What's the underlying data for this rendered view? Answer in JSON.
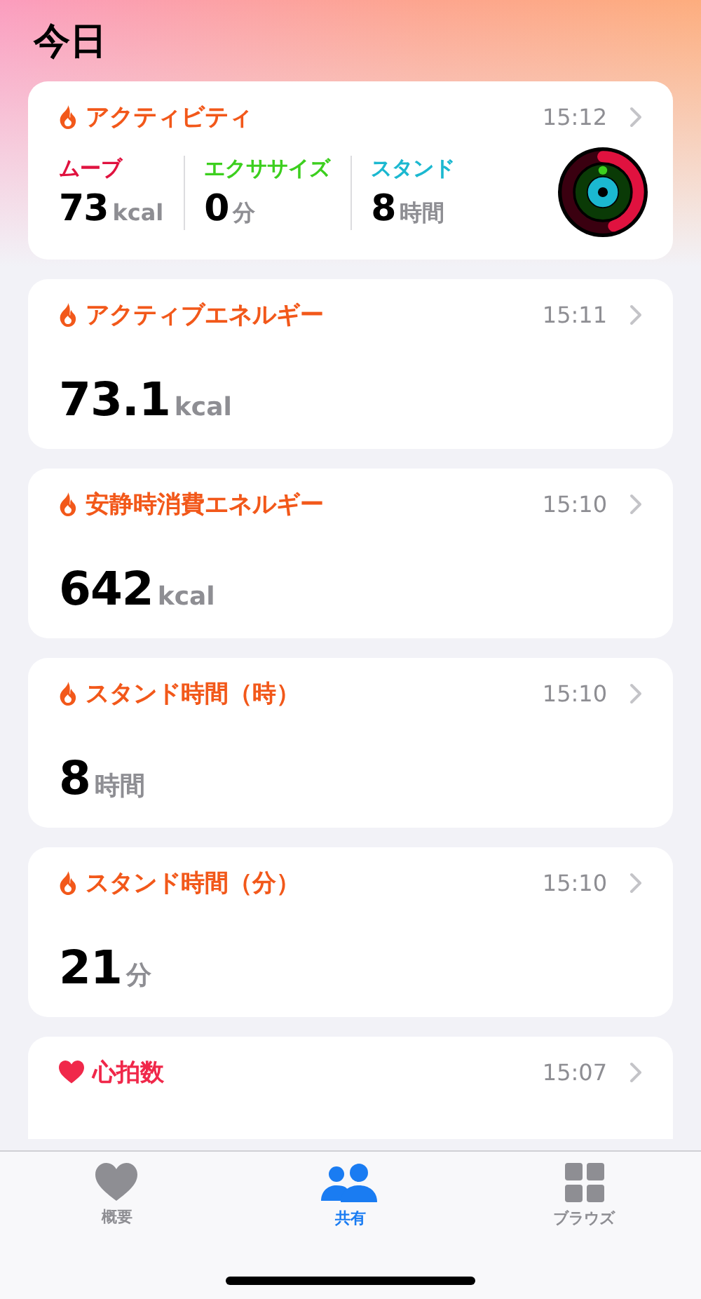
{
  "title": "今日",
  "activity_card": {
    "title": "アクティビティ",
    "time": "15:12",
    "metrics": [
      {
        "name": "ムーブ",
        "value": "73",
        "unit": "kcal",
        "color": "#e0123f"
      },
      {
        "name": "エクササイズ",
        "value": "0",
        "unit": "分",
        "color": "#3ccf1e"
      },
      {
        "name": "スタンド",
        "value": "8",
        "unit": "時間",
        "color": "#1bb8d0"
      }
    ]
  },
  "cards": [
    {
      "kind": "flame",
      "title": "アクティブエネルギー",
      "time": "15:11",
      "value": "73.1",
      "unit": "kcal"
    },
    {
      "kind": "flame",
      "title": "安静時消費エネルギー",
      "time": "15:10",
      "value": "642",
      "unit": "kcal"
    },
    {
      "kind": "flame",
      "title": "スタンド時間（時）",
      "time": "15:10",
      "value": "8",
      "unit": "時間"
    },
    {
      "kind": "flame",
      "title": "スタンド時間（分）",
      "time": "15:10",
      "value": "21",
      "unit": "分"
    },
    {
      "kind": "heart",
      "title": "心拍数",
      "time": "15:07"
    }
  ],
  "tabs": [
    {
      "kind": "heart",
      "label": "概要",
      "selected": false
    },
    {
      "kind": "people",
      "label": "共有",
      "selected": true
    },
    {
      "kind": "grid",
      "label": "ブラウズ",
      "selected": false
    }
  ]
}
